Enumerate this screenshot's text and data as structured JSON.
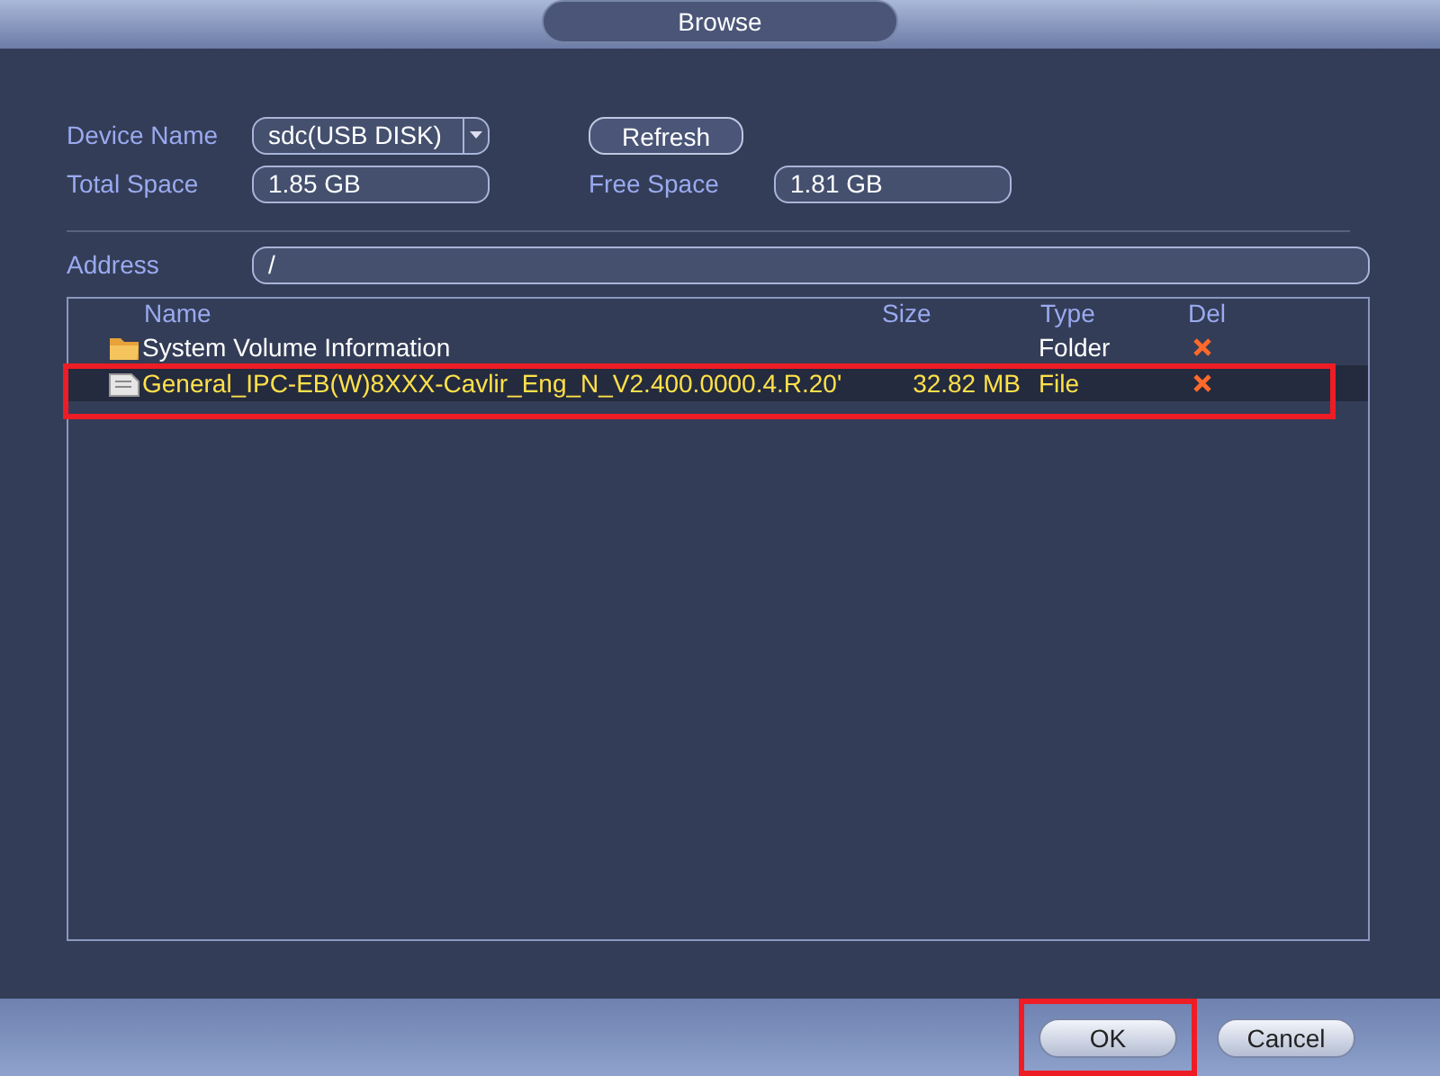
{
  "window": {
    "title": "Browse"
  },
  "device": {
    "label": "Device Name",
    "value": "sdc(USB DISK)"
  },
  "refresh_button": "Refresh",
  "total_space": {
    "label": "Total Space",
    "value": "1.85 GB"
  },
  "free_space": {
    "label": "Free Space",
    "value": "1.81 GB"
  },
  "address": {
    "label": "Address",
    "value": "/"
  },
  "table": {
    "columns": [
      "Name",
      "Size",
      "Type",
      "Del"
    ],
    "rows": [
      {
        "kind": "folder",
        "name": "System Volume Information",
        "size": "",
        "type": "Folder",
        "selected": false,
        "highlighted": false
      },
      {
        "kind": "file",
        "name": "General_IPC-EB(W)8XXX-Cavlir_Eng_N_V2.400.0000.4.R.20'",
        "size": "32.82 MB",
        "type": "File",
        "selected": true,
        "highlighted": true
      }
    ]
  },
  "buttons": [
    {
      "label": "OK",
      "highlighted": true
    },
    {
      "label": "Cancel",
      "highlighted": false
    }
  ]
}
